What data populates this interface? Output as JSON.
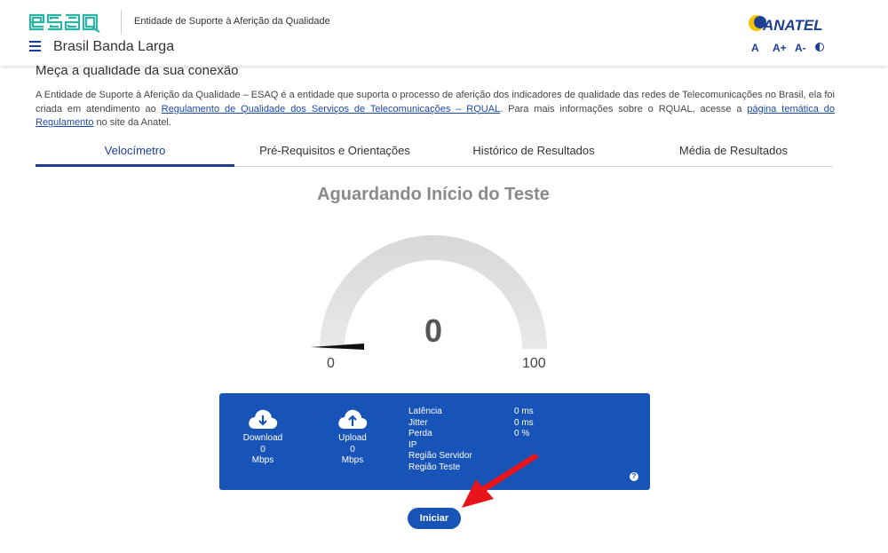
{
  "header": {
    "esaq_logo_text": "esaq",
    "tagline": "Entidade de Suporte à Aferição da Qualidade",
    "site_title": "Brasil Banda Larga",
    "anatel_logo_text": "ANATEL",
    "accessibility": {
      "font_normal": "A",
      "font_increase": "A+",
      "font_decrease": "A-",
      "contrast_icon": "contrast-icon"
    },
    "menu_icon": "hamburger-icon"
  },
  "main": {
    "heading": "Meça a qualidade da sua conexão",
    "intro": {
      "part1": "A Entidade de Suporte à Aferição da Qualidade – ESAQ é a entidade que suporta o processo de aferição dos indicadores de qualidade das redes de Telecomunicações no Brasil, ela foi criada em atendimento ao ",
      "link1": "Regulamento de Qualidade dos Serviços de Telecomunicações – RQUAL",
      "part2": ". Para mais informações sobre o RQUAL, acesse a ",
      "link2": "página temática do Regulamento",
      "part3": " no site da Anatel."
    },
    "tabs": [
      {
        "label": "Velocímetro",
        "active": true
      },
      {
        "label": "Pré-Requisitos e Orientações",
        "active": false
      },
      {
        "label": "Histórico de Resultados",
        "active": false
      },
      {
        "label": "Média de Resultados",
        "active": false
      }
    ],
    "status_title": "Aguardando Início do Teste",
    "gauge": {
      "value": "0",
      "min_label": "0",
      "max_label": "100"
    },
    "results": {
      "download": {
        "label": "Download",
        "value": "0",
        "unit": "Mbps",
        "icon": "cloud-download-icon"
      },
      "upload": {
        "label": "Upload",
        "value": "0",
        "unit": "Mbps",
        "icon": "cloud-upload-icon"
      },
      "stats": [
        {
          "label": "Latência",
          "value": "0 ms"
        },
        {
          "label": "Jitter",
          "value": "0 ms"
        },
        {
          "label": "Perda",
          "value": "0 %"
        },
        {
          "label": "IP",
          "value": ""
        },
        {
          "label": "Região Servidor",
          "value": ""
        },
        {
          "label": "Região Teste",
          "value": ""
        }
      ],
      "help": "?"
    },
    "start_button": "Iniciar"
  },
  "colors": {
    "brand_blue": "#1853b8",
    "esaq_teal": "#2bb3a3",
    "anatel_yellow": "#f5c400",
    "arrow_red": "#e8141c"
  }
}
